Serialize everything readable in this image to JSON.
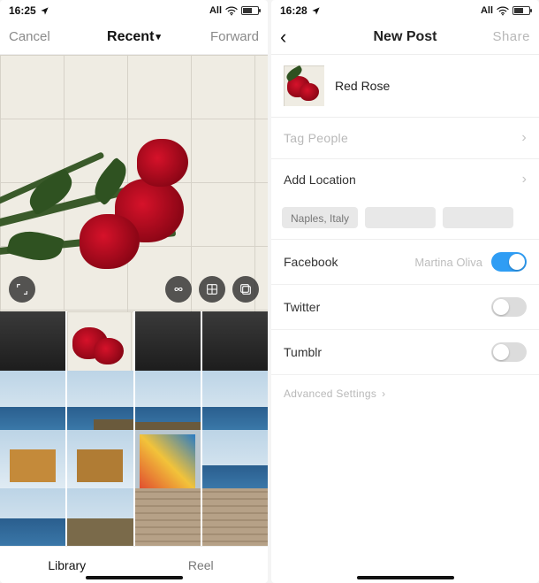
{
  "left": {
    "status": {
      "time": "16:25",
      "network": "All"
    },
    "nav": {
      "cancel": "Cancel",
      "title": "Recent",
      "forward": "Forward"
    },
    "preview_controls": {
      "expand": "expand",
      "boomerang": "boomerang",
      "layout": "layout",
      "multi": "multi-select"
    },
    "tabs": {
      "library": "Library",
      "reel": "Reel"
    }
  },
  "right": {
    "status": {
      "time": "16:28",
      "network": "All"
    },
    "nav": {
      "back": "Back",
      "title": "New Post",
      "share": "Share"
    },
    "caption": "Red Rose",
    "tag_people": "Tag People",
    "add_location": "Add Location",
    "suggestions": [
      "Naples, Italy",
      "",
      ""
    ],
    "sharing": {
      "facebook": {
        "label": "Facebook",
        "account": "Martina Oliva",
        "on": true
      },
      "twitter": {
        "label": "Twitter",
        "on": false
      },
      "tumblr": {
        "label": "Tumblr",
        "on": false
      }
    },
    "advanced": "Advanced Settings"
  }
}
